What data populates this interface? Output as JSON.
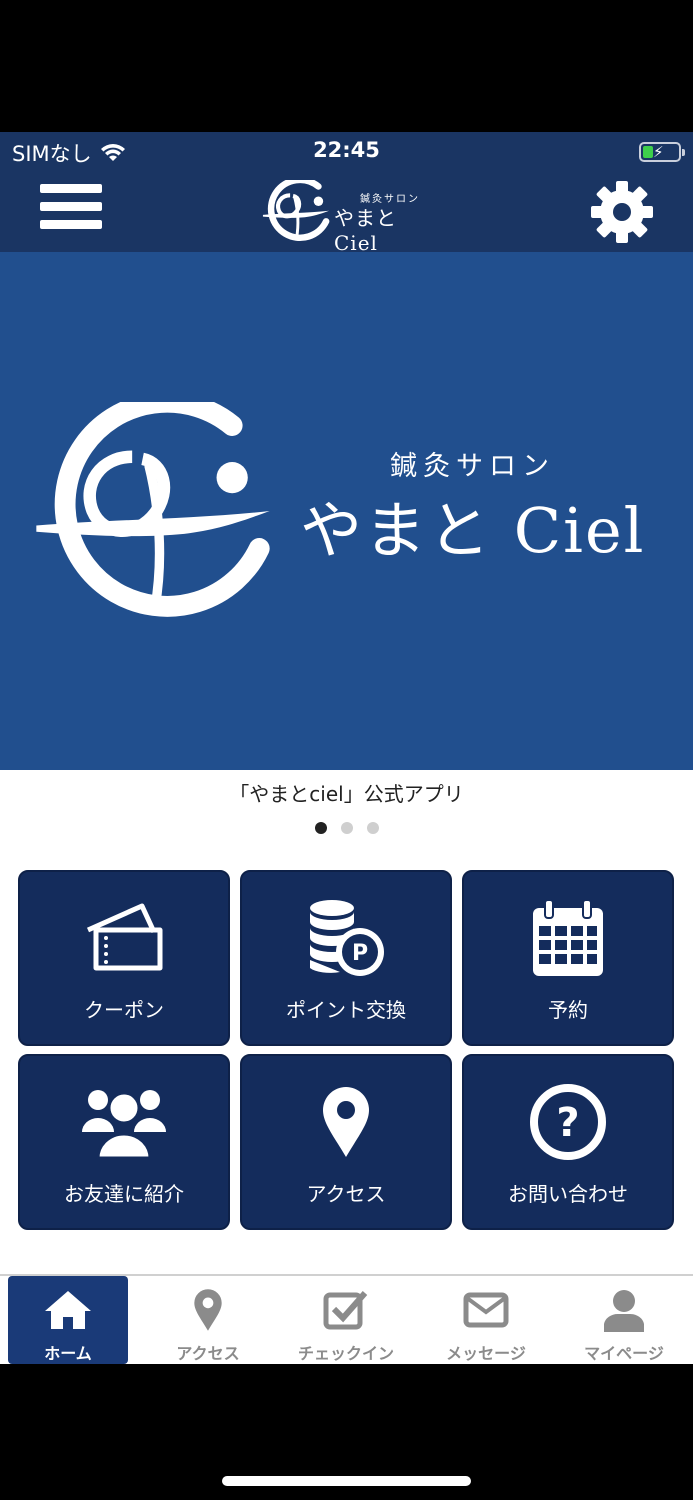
{
  "status_bar": {
    "carrier": "SIMなし",
    "time": "22:45"
  },
  "header": {
    "logo_sub": "鍼灸サロン",
    "logo_name": "やまとCiel"
  },
  "hero": {
    "sub": "鍼灸サロン",
    "name": "やまと Ciel"
  },
  "caption": "「やまとciel」公式アプリ",
  "tiles": [
    {
      "label": "クーポン",
      "icon": "ticket-icon"
    },
    {
      "label": "ポイント交換",
      "icon": "coins-point-icon"
    },
    {
      "label": "予約",
      "icon": "calendar-icon"
    },
    {
      "label": "お友達に紹介",
      "icon": "users-group-icon"
    },
    {
      "label": "アクセス",
      "icon": "map-pin-icon"
    },
    {
      "label": "お問い合わせ",
      "icon": "question-circle-icon"
    }
  ],
  "tabs": [
    {
      "label": "ホーム",
      "icon": "home-icon"
    },
    {
      "label": "アクセス",
      "icon": "map-pin-icon"
    },
    {
      "label": "チェックイン",
      "icon": "checkbox-icon"
    },
    {
      "label": "メッセージ",
      "icon": "envelope-icon"
    },
    {
      "label": "マイページ",
      "icon": "user-icon"
    }
  ],
  "colors": {
    "header_bg": "#1a3563",
    "hero_bg": "#214f8e",
    "tile_bg": "#142c5c",
    "tab_active_bg": "#1a3a78",
    "tab_inactive_text": "#8b8b8b"
  }
}
